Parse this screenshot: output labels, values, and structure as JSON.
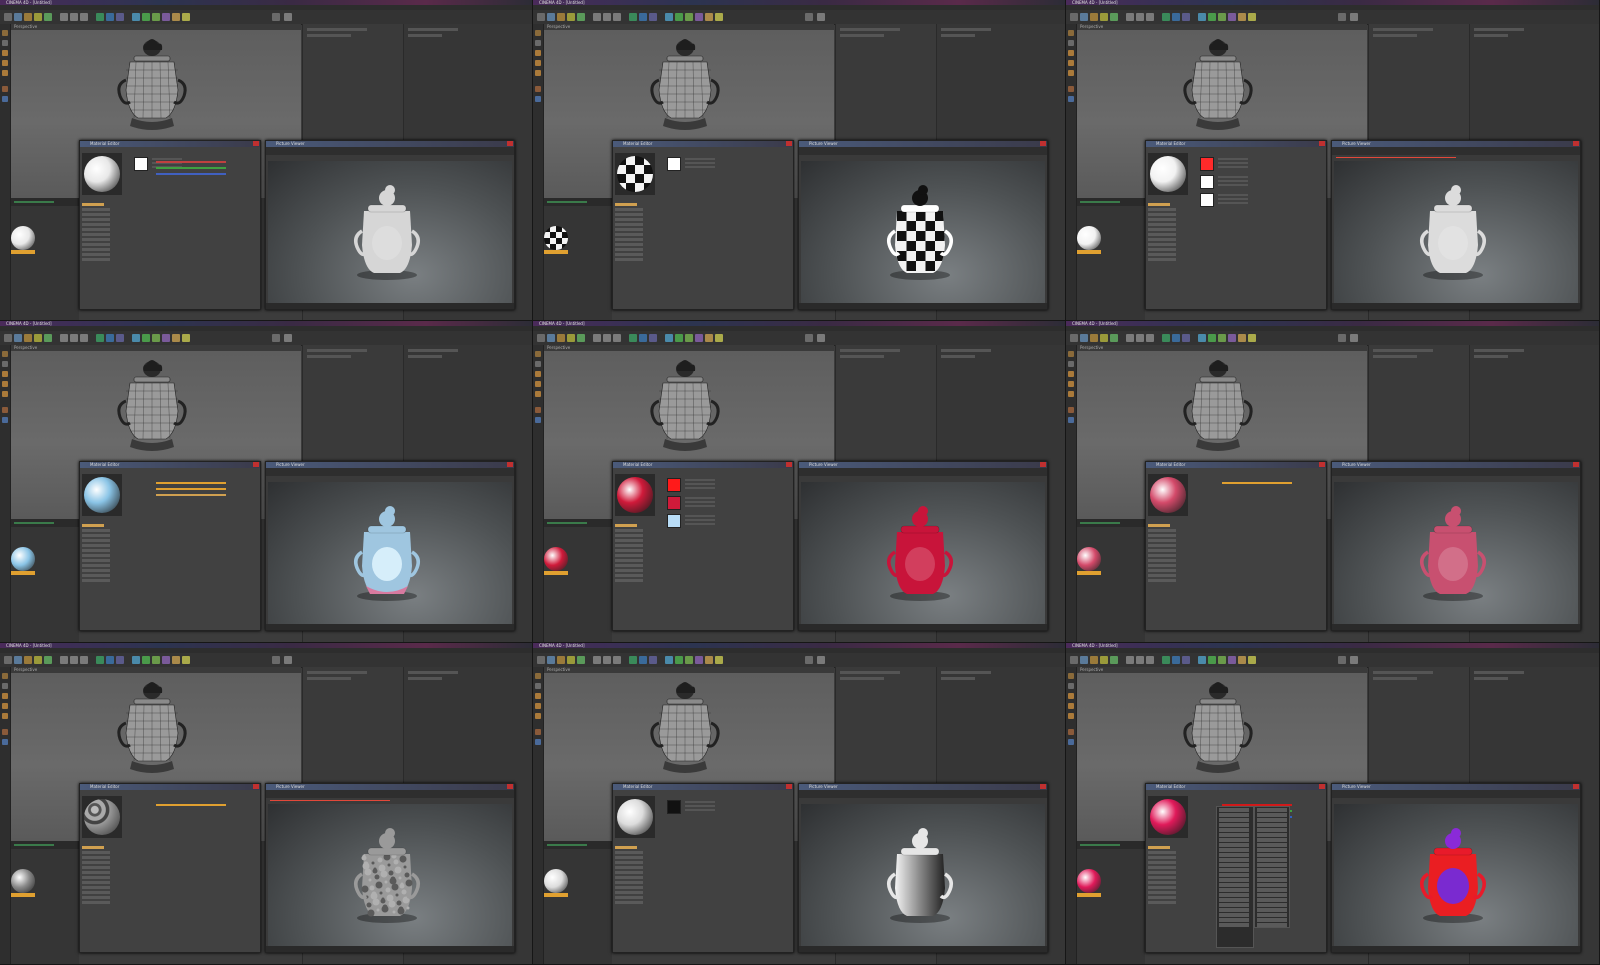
{
  "app": {
    "window_title": "CINEMA 4D - [Untitled]",
    "viewport_label": "Perspective",
    "material_editor_title": "Material Editor",
    "render_window_title": "Picture Viewer"
  },
  "tiles": [
    {
      "id": "t1",
      "material": "white",
      "ball": "#e8e8e8",
      "render_tint": "#d6d6d6",
      "pattern": "plain",
      "label": "Color",
      "swatches": [
        "#ffffff"
      ],
      "bars": [
        "#c04040",
        "#40a040",
        "#4060c0"
      ]
    },
    {
      "id": "t2",
      "material": "checker",
      "ball": "#f4f4f4",
      "render_tint": "#ffffff",
      "pattern": "checker",
      "label": "Color",
      "swatches": [
        "#ffffff"
      ],
      "bars": []
    },
    {
      "id": "t3",
      "material": "white-layered",
      "ball": "#f2f2f2",
      "render_tint": "#dcdcdc",
      "pattern": "plain",
      "label": "Luminance",
      "swatches": [
        "#ff2a2a",
        "#ffffff",
        "#ffffff"
      ],
      "bars": [],
      "error": true
    },
    {
      "id": "t4",
      "material": "light-blue",
      "ball": "#8ac4e6",
      "render_tint": "#9fc6e0",
      "pattern": "blue",
      "label": "Color",
      "swatches": [],
      "bars": [
        "#e0a030",
        "#e0a030",
        "#d0a050"
      ]
    },
    {
      "id": "t5",
      "material": "red",
      "ball": "#d01a3a",
      "render_tint": "#c8143a",
      "pattern": "red",
      "label": "Reflectance",
      "swatches": [
        "#ff1a1a",
        "#d01a3a",
        "#b8dcf6"
      ],
      "bars": []
    },
    {
      "id": "t6",
      "material": "pink-red",
      "ball": "#d44a6a",
      "render_tint": "#c85070",
      "pattern": "pink",
      "label": "Color",
      "swatches": [],
      "bars": [
        "#e0a030"
      ]
    },
    {
      "id": "t7",
      "material": "displacement-noise",
      "ball": "#8a8a8a",
      "render_tint": "#9a9a9a",
      "pattern": "noise",
      "label": "Displacement",
      "swatches": [],
      "bars": [
        "#e0a030"
      ],
      "error": true
    },
    {
      "id": "t8",
      "material": "black-white-gradient",
      "ball": "#dcdcdc",
      "render_tint": "#e6e6e6",
      "pattern": "bw",
      "label": "Color",
      "swatches": [
        "#111111"
      ],
      "bars": []
    },
    {
      "id": "t9",
      "material": "magenta-red",
      "ball": "#e01a5a",
      "render_tint": "#e81a2a",
      "pattern": "magenta",
      "label": "Color",
      "swatches": [],
      "bars": [
        "#d01a1a",
        "#40a040",
        "#3060c0"
      ],
      "dropdown": true
    }
  ]
}
